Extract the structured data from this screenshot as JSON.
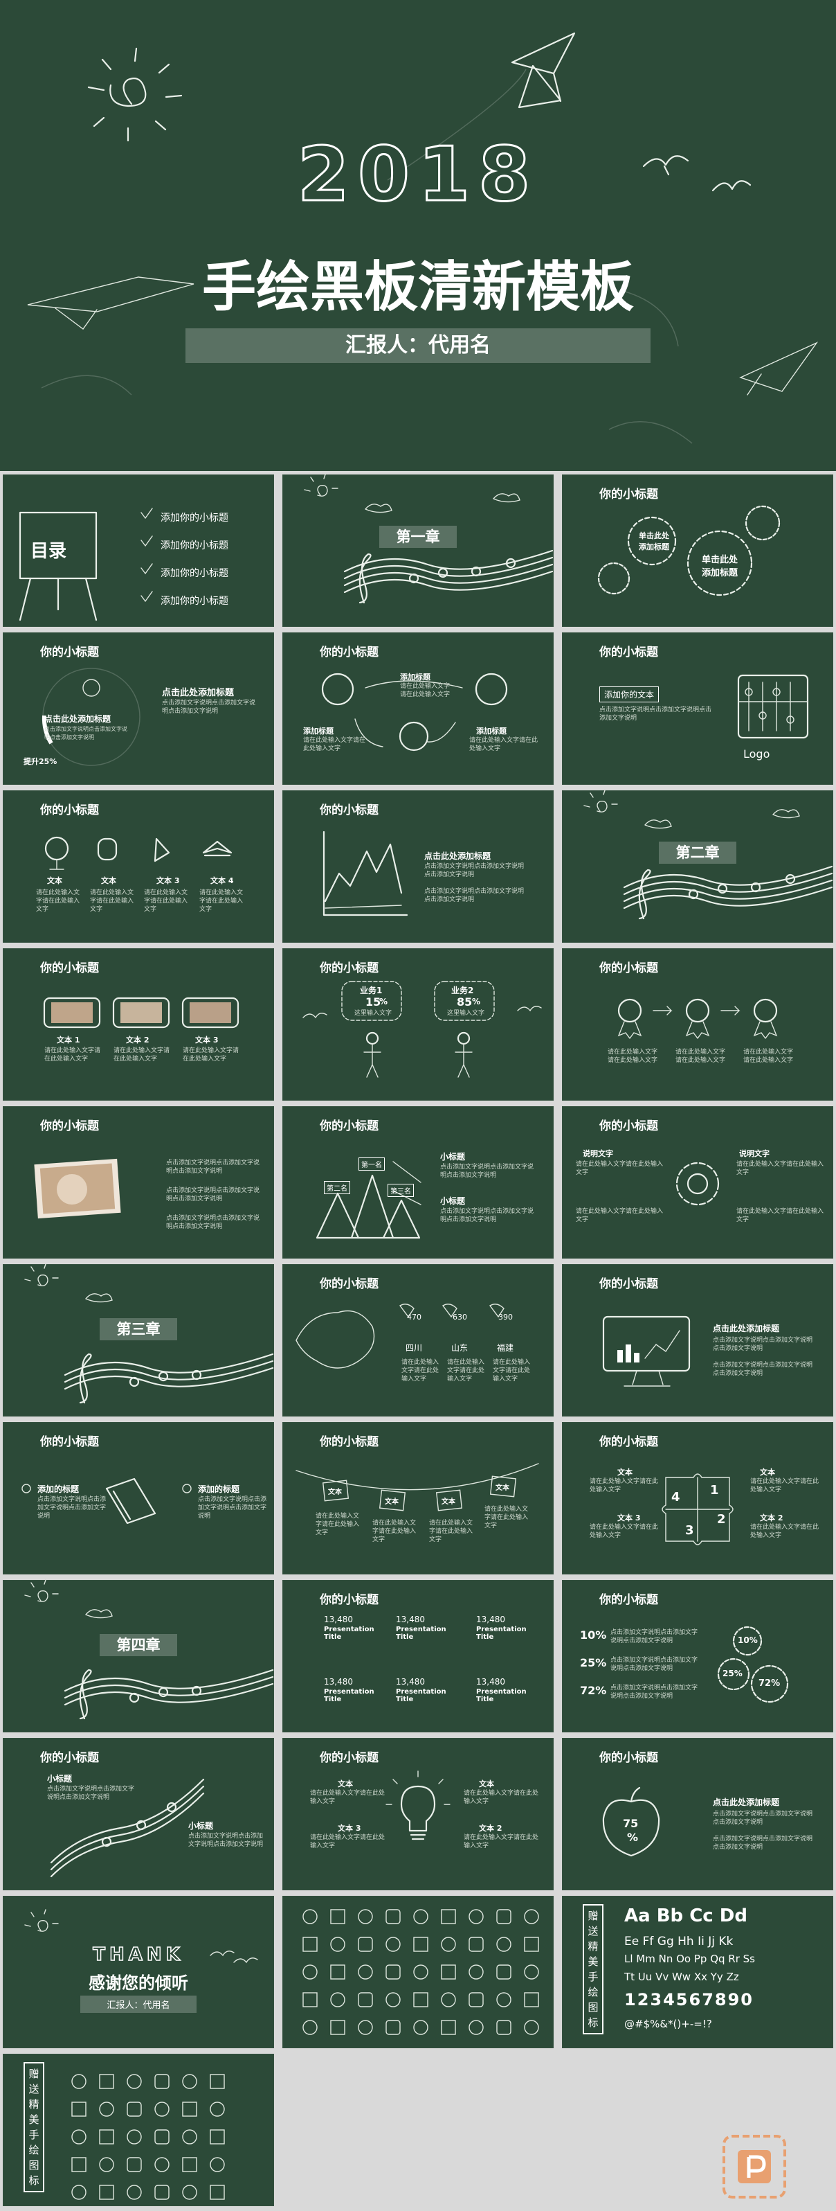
{
  "hero": {
    "year": "2018",
    "title": "手绘黑板清新模板",
    "reporter": "汇报人：代用名"
  },
  "common": {
    "subtitle": "你的小标题",
    "body_text": "点击添加文字说明点击添加文字说明点击添加文字说明",
    "fill_text": "请在此处输入文字请在此处输入文字"
  },
  "toc": {
    "title": "目录",
    "items": [
      "添加你的小标题",
      "添加你的小标题",
      "添加你的小标题",
      "添加你的小标题"
    ]
  },
  "chapters": [
    "第一章",
    "第二章",
    "第三章",
    "第四章"
  ],
  "s3": {
    "left": "单击此处添加标题",
    "right": "单击此处添加标题"
  },
  "s4": {
    "heading": "点击此处添加标题",
    "progress": "提升25%"
  },
  "s5": {
    "label_top": "添加标题",
    "label_left": "添加标题",
    "label_right": "添加标题"
  },
  "s6": {
    "heading": "添加你的文本",
    "logo": "Logo"
  },
  "s7": {
    "labels": [
      "文本",
      "文本",
      "文本 3",
      "文本 4"
    ]
  },
  "s8": {
    "heading": "点击此处添加标题"
  },
  "s10": {
    "labels": [
      "文本 1",
      "文本 2",
      "文本 3"
    ]
  },
  "s11": {
    "left": "业务1",
    "left_value": "15",
    "right": "业务2",
    "right_value": "85",
    "unit": "%",
    "note": "这里输入文字"
  },
  "s13": {
    "labels": [
      "第一名",
      "第二名",
      "第三名"
    ],
    "heads": [
      "小标题",
      "小标题"
    ]
  },
  "s15": {
    "head1": "说明文字",
    "head2": "说明文字"
  },
  "s16": {
    "values": [
      "470",
      "630",
      "390"
    ],
    "provinces": [
      "四川",
      "山东",
      "福建"
    ]
  },
  "s17": {
    "heading": "点击此处添加标题"
  },
  "s18": {
    "heads": [
      "添加的标题",
      "添加的标题"
    ]
  },
  "s19": {
    "tags": [
      "文本",
      "文本",
      "文本",
      "文本"
    ]
  },
  "s20": {
    "labels": [
      "文本",
      "文本",
      "文本 3",
      "文本 2"
    ],
    "nums": [
      "4",
      "1",
      "2",
      "3"
    ]
  },
  "s22": {
    "value": "13,480",
    "sub": "Presentation Title"
  },
  "s23": {
    "pcts": [
      "10%",
      "25%",
      "72%"
    ]
  },
  "s24": {
    "heads": [
      "小标题",
      "小标题"
    ]
  },
  "s25": {
    "labels": [
      "文本",
      "文本",
      "文本 3",
      "文本 2"
    ]
  },
  "s26": {
    "heading": "点击此处添加标题",
    "value": "75",
    "unit": "%"
  },
  "s27": {
    "thanks_en": "THANK",
    "thanks_cn": "感谢您的倾听",
    "reporter": "汇报人：代用名"
  },
  "bonus": {
    "font_tag": "赠送精美手绘图标",
    "letters1": "Aa Bb Cc Dd",
    "letters2": "Ee Ff Gg Hh Ii Jj Kk",
    "letters3": "Ll Mm Nn Oo Pp Qq Rr Ss",
    "letters4": "Tt Uu Vv Ww Xx Yy Zz",
    "digits": "1234567890",
    "symbols": "@#$%&*()+-=!?"
  },
  "colors": {
    "board": "#2c4a38",
    "chalk": "#e9efe9",
    "page": "#d9d9d9",
    "logo": "#e8a070"
  }
}
